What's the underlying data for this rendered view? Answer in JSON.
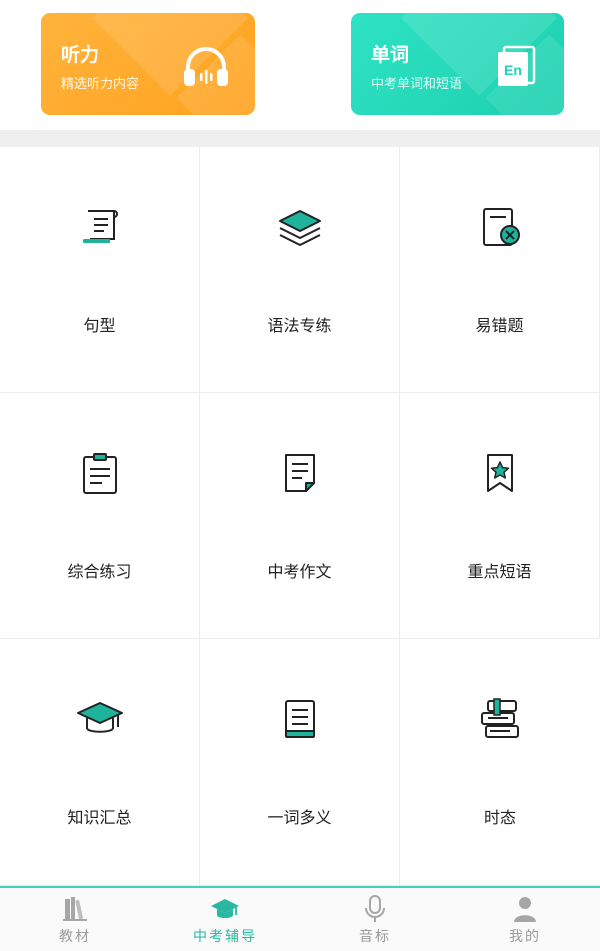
{
  "feature_cards": [
    {
      "title": "听力",
      "subtitle": "精选听力内容",
      "icon": "headphones-icon",
      "color": "#ffa726"
    },
    {
      "title": "单词",
      "subtitle": "中考单词和短语",
      "icon": "en-book-icon",
      "icon_text": "En",
      "color": "#1fd3b2"
    }
  ],
  "grid_items": [
    {
      "label": "句型",
      "icon": "scroll-icon"
    },
    {
      "label": "语法专练",
      "icon": "layers-icon"
    },
    {
      "label": "易错题",
      "icon": "error-doc-icon"
    },
    {
      "label": "综合练习",
      "icon": "clipboard-icon"
    },
    {
      "label": "中考作文",
      "icon": "document-icon"
    },
    {
      "label": "重点短语",
      "icon": "bookmark-star-icon"
    },
    {
      "label": "知识汇总",
      "icon": "graduation-cap-icon"
    },
    {
      "label": "一词多义",
      "icon": "book-icon"
    },
    {
      "label": "时态",
      "icon": "books-stack-icon"
    }
  ],
  "tabs": [
    {
      "label": "教材",
      "icon": "bookshelf-icon",
      "active": false
    },
    {
      "label": "中考辅导",
      "icon": "graduation-cap-icon",
      "active": true
    },
    {
      "label": "音标",
      "icon": "microphone-icon",
      "active": false
    },
    {
      "label": "我的",
      "icon": "person-icon",
      "active": false
    }
  ],
  "colors": {
    "accent": "#2ab7a3",
    "icon_fill": "#1fb39c",
    "orange": "#ffa726",
    "teal": "#1fd3b2"
  }
}
